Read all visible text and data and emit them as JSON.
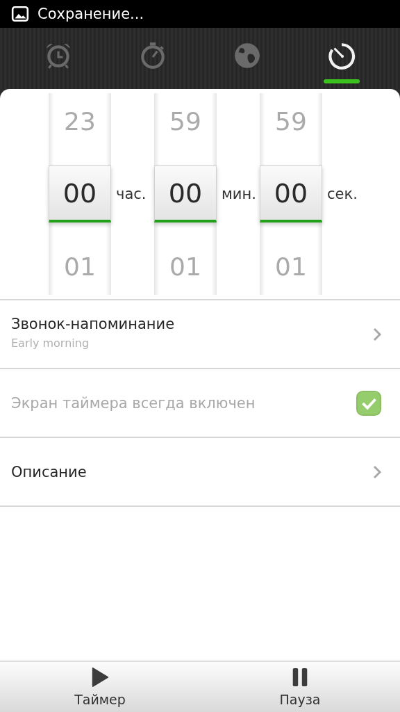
{
  "status_bar": {
    "text": "Сохранение..."
  },
  "tabs": [
    {
      "kind": "alarm",
      "selected": false
    },
    {
      "kind": "stopwatch",
      "selected": false
    },
    {
      "kind": "globe",
      "selected": false
    },
    {
      "kind": "timer",
      "selected": true
    }
  ],
  "picker": [
    {
      "above": "23",
      "value": "00",
      "below": "01",
      "unit": "час."
    },
    {
      "above": "59",
      "value": "00",
      "below": "01",
      "unit": "мин."
    },
    {
      "above": "59",
      "value": "00",
      "below": "01",
      "unit": "сек."
    }
  ],
  "settings": [
    {
      "kind": "link",
      "title": "Звонок-напоминание",
      "subtitle": "Early morning"
    },
    {
      "kind": "checkbox",
      "title": "Экран таймера всегда включен",
      "checked": true,
      "disabled": true
    },
    {
      "kind": "link",
      "title": "Описание"
    }
  ],
  "actions": [
    {
      "kind": "play",
      "label": "Таймер"
    },
    {
      "kind": "pause",
      "label": "Пауза"
    }
  ]
}
